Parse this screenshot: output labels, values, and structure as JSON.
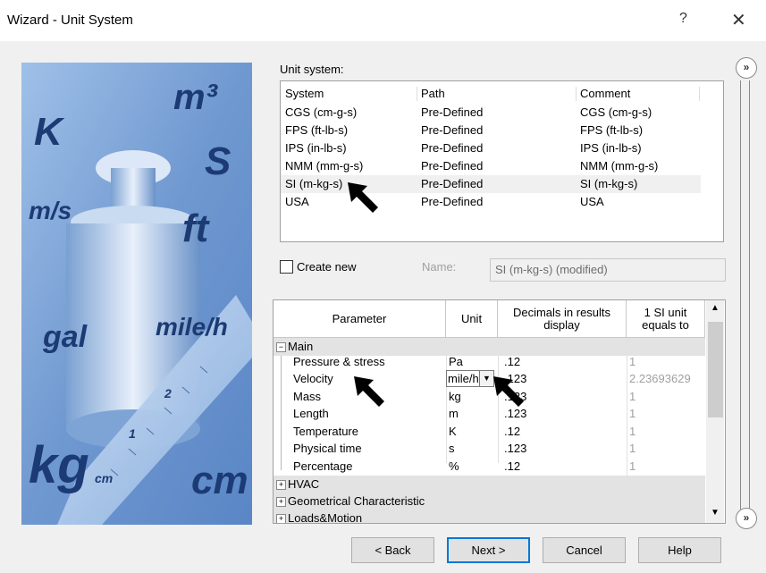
{
  "window": {
    "title": "Wizard - Unit System",
    "help_glyph": "?",
    "close_glyph": "✕"
  },
  "sidebar_image": {
    "labels": [
      "K",
      "m³",
      "S",
      "m/s",
      "ft",
      "gal",
      "mile/h",
      "kg",
      "cm",
      "1",
      "2",
      "cm"
    ]
  },
  "unit_system": {
    "label": "Unit system:",
    "columns": [
      "System",
      "Path",
      "Comment"
    ],
    "rows": [
      {
        "system": "CGS (cm-g-s)",
        "path": "Pre-Defined",
        "comment": "CGS (cm-g-s)"
      },
      {
        "system": "FPS (ft-lb-s)",
        "path": "Pre-Defined",
        "comment": "FPS (ft-lb-s)"
      },
      {
        "system": "IPS (in-lb-s)",
        "path": "Pre-Defined",
        "comment": "IPS (in-lb-s)"
      },
      {
        "system": "NMM (mm-g-s)",
        "path": "Pre-Defined",
        "comment": "NMM (mm-g-s)"
      },
      {
        "system": "SI (m-kg-s)",
        "path": "Pre-Defined",
        "comment": "SI (m-kg-s)"
      },
      {
        "system": "USA",
        "path": "Pre-Defined",
        "comment": "USA"
      }
    ],
    "selected_index": 4
  },
  "create_new": {
    "label": "Create new",
    "checked": false,
    "name_label": "Name:",
    "name_value": "SI (m-kg-s) (modified)"
  },
  "params": {
    "headers": {
      "parameter": "Parameter",
      "unit": "Unit",
      "decimals": "Decimals in results display",
      "equals": "1 SI unit equals to"
    },
    "groups": {
      "main": "Main",
      "hvac": "HVAC",
      "geo": "Geometrical Characteristic",
      "loads": "Loads&Motion"
    },
    "rows": [
      {
        "name": "Pressure & stress",
        "unit": "Pa",
        "decimals": ".12",
        "equals": "1"
      },
      {
        "name": "Velocity",
        "unit": "mile/h",
        "decimals": ".123",
        "equals": "2.23693629"
      },
      {
        "name": "Mass",
        "unit": "kg",
        "decimals": ".123",
        "equals": "1"
      },
      {
        "name": "Length",
        "unit": "m",
        "decimals": ".123",
        "equals": "1"
      },
      {
        "name": "Temperature",
        "unit": "K",
        "decimals": ".12",
        "equals": "1"
      },
      {
        "name": "Physical time",
        "unit": "s",
        "decimals": ".123",
        "equals": "1"
      },
      {
        "name": "Percentage",
        "unit": "%",
        "decimals": ".12",
        "equals": "1"
      }
    ]
  },
  "buttons": {
    "back": "< Back",
    "next": "Next >",
    "cancel": "Cancel",
    "help": "Help"
  },
  "rail": {
    "glyph": "»"
  },
  "colors": {
    "accent": "#0078d7",
    "image_bg": "#7fa7d8"
  }
}
